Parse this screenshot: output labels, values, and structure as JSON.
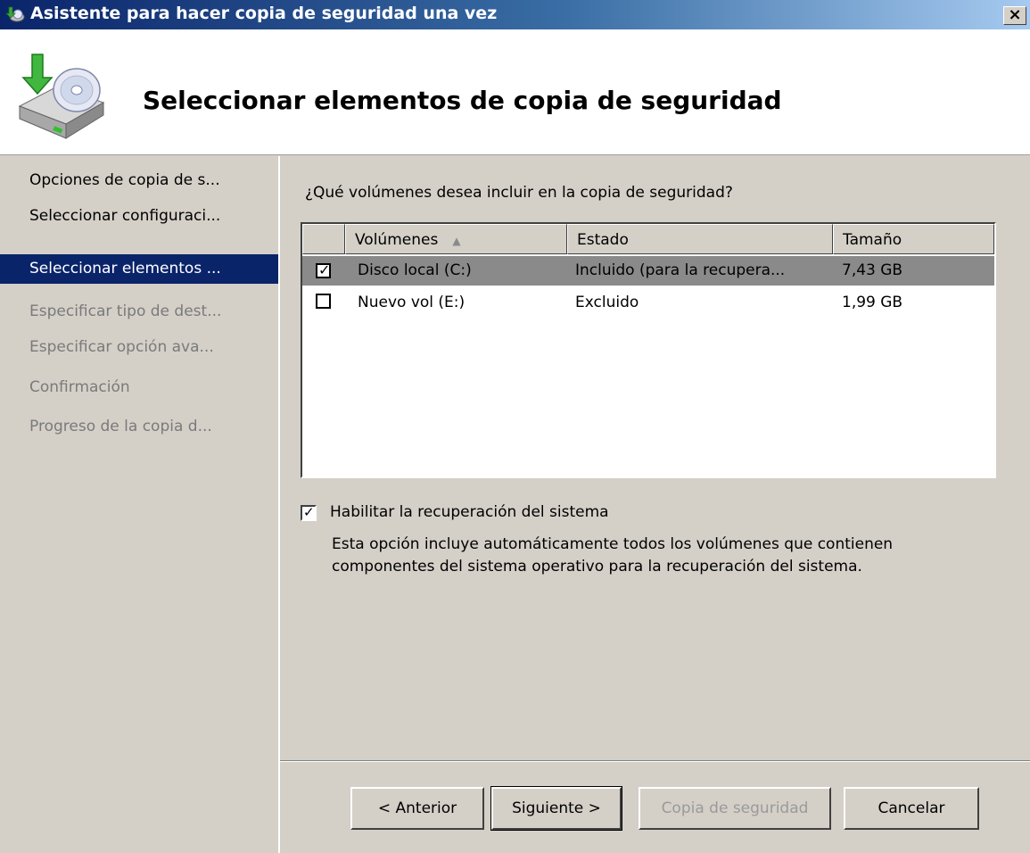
{
  "window": {
    "title": "Asistente para hacer copia de seguridad una vez",
    "close_label": "×"
  },
  "header": {
    "title": "Seleccionar elementos de copia de seguridad",
    "icon": "backup-disk-icon"
  },
  "steps": [
    {
      "label": "Opciones de copia de s...",
      "state": "done"
    },
    {
      "label": "Seleccionar configuraci...",
      "state": "done"
    },
    {
      "label": "Seleccionar elementos ...",
      "state": "active"
    },
    {
      "label": "Especificar tipo de dest...",
      "state": "pending"
    },
    {
      "label": "Especificar opción ava...",
      "state": "pending"
    },
    {
      "label": "Confirmación",
      "state": "pending"
    },
    {
      "label": "Progreso de la copia d...",
      "state": "pending"
    }
  ],
  "main": {
    "question": "¿Qué volúmenes desea incluir en la copia de seguridad?",
    "columns": {
      "volumes": "Volúmenes",
      "state": "Estado",
      "size": "Tamaño"
    },
    "rows": [
      {
        "checked": true,
        "volume": "Disco local (C:)",
        "state": "Incluido (para la recupera...",
        "size": "7,43 GB"
      },
      {
        "checked": false,
        "volume": "Nuevo vol (E:)",
        "state": "Excluido",
        "size": "1,99 GB"
      }
    ],
    "system_recovery": {
      "checked": true,
      "label": "Habilitar la recuperación del sistema",
      "description": "Esta opción incluye automáticamente todos los volúmenes que contienen componentes del sistema operativo para la recuperación del sistema."
    }
  },
  "buttons": {
    "back": "< Anterior",
    "next": "Siguiente >",
    "backup": "Copia de seguridad",
    "cancel": "Cancelar"
  },
  "colors": {
    "accent": "#0a246a",
    "face": "#d4d0c8",
    "selected_row": "#8a8a8a",
    "disabled_text": "#9a9a9a"
  }
}
